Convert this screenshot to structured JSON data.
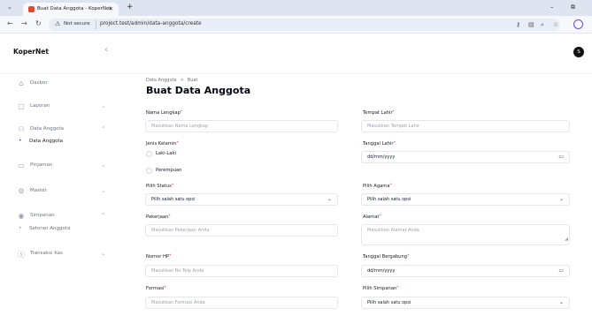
{
  "browser": {
    "tab_title": "Buat Data Anggota - KoperNet",
    "tab_close": "✕",
    "new_tab": "+",
    "security_label": "Not secure",
    "url": "project.test/admin/data-anggota/create",
    "icons": [
      "menu-chevron-icon",
      "back-icon",
      "forward-icon",
      "reload-icon",
      "warning-icon",
      "key-icon",
      "translate-icon",
      "zoom-icon",
      "star-icon",
      "profile-icon"
    ]
  },
  "app": {
    "logo": "KoperNet",
    "collapse": "‹",
    "avatar_initial": "S"
  },
  "sidebar": {
    "items": [
      {
        "label": "Dasbor",
        "icon": "⌂",
        "has_chevron": false
      },
      {
        "label": "Laporan",
        "icon": "▢",
        "chevron": "⌄"
      },
      {
        "label": "Data Anggota",
        "icon": "⚇",
        "chevron": "⌃"
      },
      {
        "label": "Data Anggota",
        "sub": true,
        "active": true
      },
      {
        "label": "Pinjaman",
        "icon": "▭",
        "chevron": "⌄"
      },
      {
        "label": "Master",
        "icon": "⚙",
        "chevron": "⌄"
      },
      {
        "label": "Simpanan",
        "icon": "◉",
        "chevron": "⌃"
      },
      {
        "label": "Setoran Anggota",
        "sub": true,
        "active": false
      },
      {
        "label": "Transaksi Kas",
        "icon": "ⓢ",
        "chevron": "⌄"
      }
    ]
  },
  "main": {
    "breadcrumb": [
      "Data Anggota",
      "Buat"
    ],
    "breadcrumb_sep": ">",
    "title": "Buat Data Anggota",
    "required_mark": "*",
    "fields": {
      "nama": {
        "label": "Nama Lengkap",
        "placeholder": "Masukkan Nama Lengkap"
      },
      "tempat": {
        "label": "Tempat Lahir",
        "placeholder": "Masukkan Tempat Lahir"
      },
      "jk": {
        "label": "Jenis Kelamin",
        "options": [
          "Laki-Laki",
          "Perempuan"
        ]
      },
      "tgl_lahir": {
        "label": "Tanggal Lahir",
        "value": "dd/mm/yyyy"
      },
      "status": {
        "label": "Pilih Status",
        "value": "Pilih salah satu opsi"
      },
      "agama": {
        "label": "Pilih Agama",
        "value": "Pilih salah satu opsi"
      },
      "pekerjaan": {
        "label": "Pekerjaan",
        "placeholder": "Masukkan Pekerjaan Anda"
      },
      "alamat": {
        "label": "Alamat",
        "placeholder": "Masukkan Alamat Anda"
      },
      "hp": {
        "label": "Nomor HP",
        "placeholder": "Masukkan No Telp Anda"
      },
      "tgl_gabung": {
        "label": "Tanggal Bergabung",
        "value": "dd/mm/yyyy"
      },
      "formasi": {
        "label": "Formasi",
        "placeholder": "Masukkan Formasi Anda"
      },
      "simpanan": {
        "label": "Pilih Simpanan",
        "value": "Pilih salah satu opsi"
      }
    }
  }
}
